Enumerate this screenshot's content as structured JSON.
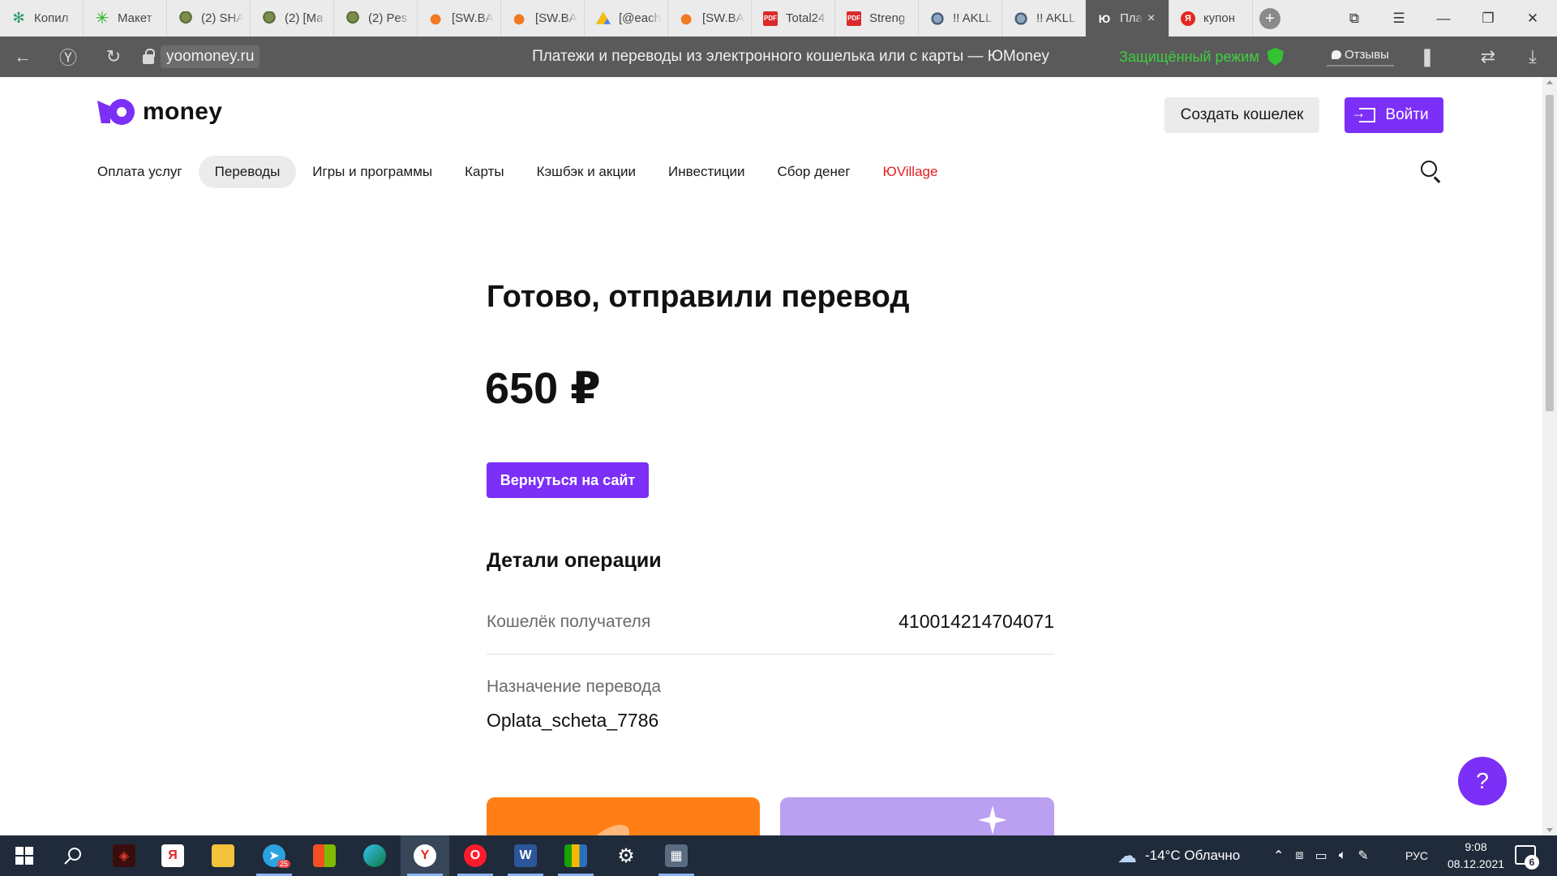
{
  "browser": {
    "tabs": [
      {
        "label": "Копил",
        "icon": "flower-icon"
      },
      {
        "label": "Макет",
        "icon": "asterisk-icon"
      },
      {
        "label": "(2) SHA",
        "icon": "tree-icon"
      },
      {
        "label": "(2) [Ma",
        "icon": "tree-icon"
      },
      {
        "label": "(2) Pes",
        "icon": "tree-icon"
      },
      {
        "label": "[SW.BA",
        "icon": "cloud-icon"
      },
      {
        "label": "[SW.BA",
        "icon": "cloud-icon"
      },
      {
        "label": "[@each",
        "icon": "drive-icon"
      },
      {
        "label": "[SW.BA",
        "icon": "cloud-icon"
      },
      {
        "label": "Total24",
        "icon": "pdf-icon"
      },
      {
        "label": "Streng",
        "icon": "pdf-icon"
      },
      {
        "label": "!! AKLL",
        "icon": "globe-icon"
      },
      {
        "label": "!! AKLL",
        "icon": "globe-icon"
      },
      {
        "label": "Пла",
        "icon": "yoomoney-icon"
      },
      {
        "label": "купон",
        "icon": "yandex-icon"
      }
    ],
    "pdf_icon_text": "PDF",
    "yu_icon_text": "Ю",
    "ya_icon_text": "Я",
    "new_tab_glyph": "+",
    "close_glyph": "×",
    "domain": "yoomoney.ru",
    "page_title": "Платежи и переводы из электронного кошелька или с карты — ЮMoney",
    "protected_mode": "Защищённый режим",
    "reviews": "Отзывы",
    "accent_protected": "#3fd03f"
  },
  "site": {
    "logo_text": "money",
    "create_wallet": "Создать кошелек",
    "login": "Войти",
    "nav": [
      {
        "label": "Оплата услуг",
        "active": false
      },
      {
        "label": "Переводы",
        "active": true
      },
      {
        "label": "Игры и программы",
        "active": false
      },
      {
        "label": "Карты",
        "active": false
      },
      {
        "label": "Кэшбэк и акции",
        "active": false
      },
      {
        "label": "Инвестиции",
        "active": false
      },
      {
        "label": "Сбор денег",
        "active": false
      },
      {
        "label": "ЮVillage",
        "active": false
      }
    ],
    "brand_color": "#7b2ff7"
  },
  "result": {
    "heading": "Готово, отправили перевод",
    "amount": "650 ₽",
    "back_button": "Вернуться на сайт",
    "details_title": "Детали операции",
    "wallet_label": "Кошелёк получателя",
    "wallet_value": "410014214704071",
    "purpose_label": "Назначение перевода",
    "purpose_value": "Oplata_scheta_7786",
    "help_glyph": "?"
  },
  "taskbar": {
    "apps": [
      "start",
      "search",
      "game",
      "yandex-browser",
      "explorer",
      "telegram",
      "store",
      "edge",
      "yandex",
      "opera",
      "word",
      "libreoffice",
      "settings",
      "calculator"
    ],
    "telegram_badge": "25",
    "weather": "-14°C  Облачно",
    "language": "РУС",
    "time": "9:08",
    "date": "08.12.2021",
    "notifications": "6"
  }
}
